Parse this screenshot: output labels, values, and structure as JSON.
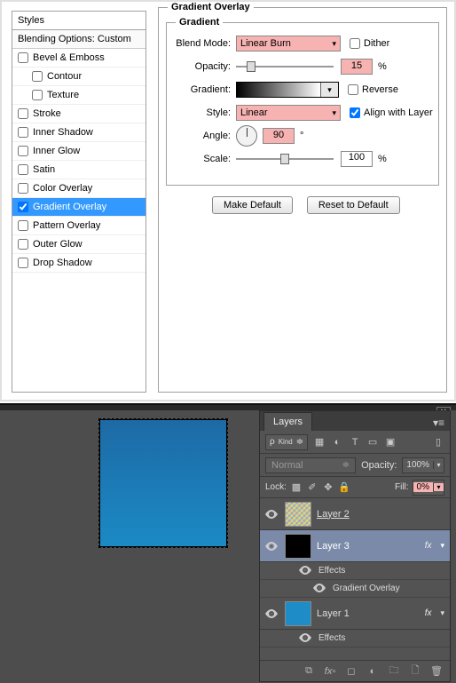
{
  "styles_panel": {
    "title": "Styles",
    "subtitle": "Blending Options: Custom",
    "items": [
      {
        "label": "Bevel & Emboss",
        "checked": false,
        "indent": 0
      },
      {
        "label": "Contour",
        "checked": false,
        "indent": 1
      },
      {
        "label": "Texture",
        "checked": false,
        "indent": 1
      },
      {
        "label": "Stroke",
        "checked": false,
        "indent": 0
      },
      {
        "label": "Inner Shadow",
        "checked": false,
        "indent": 0
      },
      {
        "label": "Inner Glow",
        "checked": false,
        "indent": 0
      },
      {
        "label": "Satin",
        "checked": false,
        "indent": 0
      },
      {
        "label": "Color Overlay",
        "checked": false,
        "indent": 0
      },
      {
        "label": "Gradient Overlay",
        "checked": true,
        "indent": 0,
        "selected": true
      },
      {
        "label": "Pattern Overlay",
        "checked": false,
        "indent": 0
      },
      {
        "label": "Outer Glow",
        "checked": false,
        "indent": 0
      },
      {
        "label": "Drop Shadow",
        "checked": false,
        "indent": 0
      }
    ]
  },
  "gradient_overlay": {
    "legend": "Gradient Overlay",
    "inner_legend": "Gradient",
    "labels": {
      "blend_mode": "Blend Mode:",
      "opacity": "Opacity:",
      "gradient": "Gradient:",
      "style": "Style:",
      "angle": "Angle:",
      "scale": "Scale:"
    },
    "blend_mode": "Linear Burn",
    "dither_label": "Dither",
    "dither_checked": false,
    "opacity": "15",
    "opacity_unit": "%",
    "reverse_label": "Reverse",
    "reverse_checked": false,
    "style": "Linear",
    "align_label": "Align with Layer",
    "align_checked": true,
    "angle": "90",
    "angle_unit": "°",
    "scale": "100",
    "scale_unit": "%",
    "make_default": "Make Default",
    "reset_default": "Reset to Default"
  },
  "layers_panel": {
    "tab": "Layers",
    "kind_label": "Kind",
    "mode": "Normal",
    "opacity_label": "Opacity:",
    "opacity": "100%",
    "lock_label": "Lock:",
    "fill_label": "Fill:",
    "fill": "0%",
    "effects_label": "Effects",
    "grad_overlay_label": "Gradient Overlay",
    "layers": [
      {
        "name": "Layer 2",
        "thumb": "noise",
        "underline": true,
        "fx": false,
        "selected": false
      },
      {
        "name": "Layer 3",
        "thumb": "black",
        "underline": false,
        "fx": true,
        "selected": true
      },
      {
        "name": "Layer 1",
        "thumb": "blue",
        "underline": false,
        "fx": true,
        "selected": false
      }
    ]
  }
}
